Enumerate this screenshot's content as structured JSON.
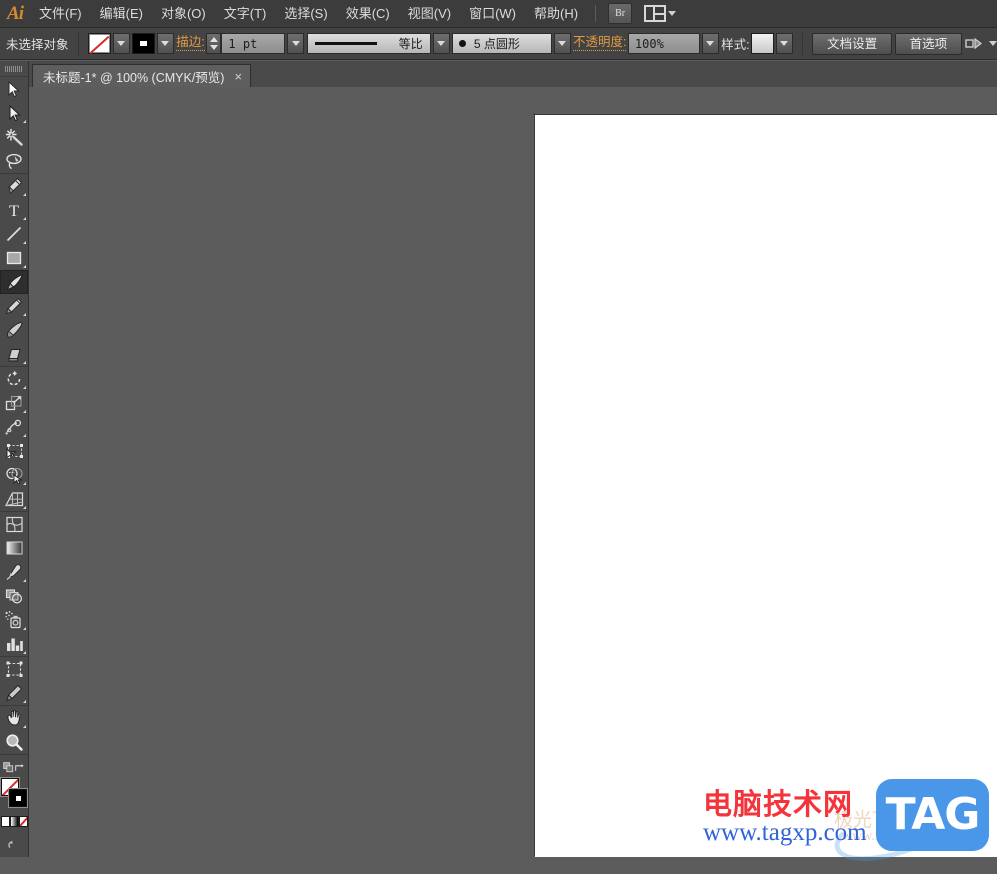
{
  "app": {
    "name": "Adobe Illustrator",
    "logo_text": "Ai",
    "bridge_button": "Br"
  },
  "menubar": {
    "items": [
      {
        "label": "文件(F)",
        "name": "menu-file"
      },
      {
        "label": "编辑(E)",
        "name": "menu-edit"
      },
      {
        "label": "对象(O)",
        "name": "menu-object"
      },
      {
        "label": "文字(T)",
        "name": "menu-type"
      },
      {
        "label": "选择(S)",
        "name": "menu-select"
      },
      {
        "label": "效果(C)",
        "name": "menu-effect"
      },
      {
        "label": "视图(V)",
        "name": "menu-view"
      },
      {
        "label": "窗口(W)",
        "name": "menu-window"
      },
      {
        "label": "帮助(H)",
        "name": "menu-help"
      }
    ]
  },
  "controlbar": {
    "selection_status": "未选择对象",
    "fill_swatch_value": "无",
    "stroke_swatch_value": "黑色",
    "stroke_label": "描边:",
    "stroke_weight": "1 pt",
    "stroke_profile": "等比",
    "brush_definition": "5 点圆形",
    "opacity_label": "不透明度:",
    "opacity_value": "100%",
    "style_label": "样式:",
    "document_setup_button": "文档设置",
    "preferences_button": "首选项"
  },
  "tabbar": {
    "document_title": "未标题-1* @ 100% (CMYK/预览)",
    "close_glyph": "×"
  },
  "toolbar": {
    "groups": [
      [
        {
          "name": "selection-tool",
          "label": "选择工具",
          "active": false,
          "corner": false
        },
        {
          "name": "direct-selection-tool",
          "label": "直接选择工具",
          "active": false,
          "corner": true
        },
        {
          "name": "magic-wand-tool",
          "label": "魔棒工具",
          "active": false,
          "corner": false
        },
        {
          "name": "lasso-tool",
          "label": "套索工具",
          "active": false,
          "corner": false
        }
      ],
      [
        {
          "name": "pen-tool",
          "label": "钢笔工具",
          "active": false,
          "corner": true
        },
        {
          "name": "type-tool",
          "label": "文字工具",
          "active": false,
          "corner": true
        },
        {
          "name": "line-segment-tool",
          "label": "直线段工具",
          "active": false,
          "corner": true
        },
        {
          "name": "rectangle-tool",
          "label": "矩形工具",
          "active": false,
          "corner": true
        },
        {
          "name": "paintbrush-tool",
          "label": "画笔工具",
          "active": true,
          "corner": false
        },
        {
          "name": "pencil-tool",
          "label": "铅笔工具",
          "active": false,
          "corner": true
        },
        {
          "name": "blob-brush-tool",
          "label": "斑点画笔工具",
          "active": false,
          "corner": false
        },
        {
          "name": "eraser-tool",
          "label": "橡皮擦工具",
          "active": false,
          "corner": true
        }
      ],
      [
        {
          "name": "rotate-tool",
          "label": "旋转工具",
          "active": false,
          "corner": true
        },
        {
          "name": "scale-tool",
          "label": "比例缩放工具",
          "active": false,
          "corner": true
        },
        {
          "name": "width-tool",
          "label": "宽度工具",
          "active": false,
          "corner": true
        },
        {
          "name": "free-transform-tool",
          "label": "自由变换工具",
          "active": false,
          "corner": false
        },
        {
          "name": "shape-builder-tool",
          "label": "形状生成器工具",
          "active": false,
          "corner": true
        },
        {
          "name": "perspective-grid-tool",
          "label": "透视网格工具",
          "active": false,
          "corner": true
        }
      ],
      [
        {
          "name": "mesh-tool",
          "label": "网格工具",
          "active": false,
          "corner": false
        },
        {
          "name": "gradient-tool",
          "label": "渐变工具",
          "active": false,
          "corner": false
        },
        {
          "name": "eyedropper-tool",
          "label": "吸管工具",
          "active": false,
          "corner": true
        },
        {
          "name": "blend-tool",
          "label": "混合工具",
          "active": false,
          "corner": false
        },
        {
          "name": "symbol-sprayer-tool",
          "label": "符号喷枪工具",
          "active": false,
          "corner": true
        },
        {
          "name": "column-graph-tool",
          "label": "柱形图工具",
          "active": false,
          "corner": true
        }
      ],
      [
        {
          "name": "artboard-tool",
          "label": "画板工具",
          "active": false,
          "corner": false
        },
        {
          "name": "slice-tool",
          "label": "切片工具",
          "active": false,
          "corner": true
        }
      ],
      [
        {
          "name": "hand-tool",
          "label": "抓手工具",
          "active": false,
          "corner": true
        },
        {
          "name": "zoom-tool",
          "label": "缩放工具",
          "active": false,
          "corner": false
        }
      ]
    ],
    "fill_value": "无",
    "stroke_value": "黑色",
    "color_modes": [
      "颜色",
      "渐变",
      "无"
    ]
  },
  "watermark": {
    "site_name_cn": "电脑技术网",
    "site_url": "www.tagxp.com",
    "logo_text": "TAG",
    "ghost_text": "极光下载站",
    "ghost_url": "www.xz7.com"
  },
  "colors": {
    "chrome_dark": "#3c3c3c",
    "chrome_mid": "#4a4a4a",
    "canvas_gray": "#5c5c5c",
    "artboard_white": "#ffffff",
    "accent_orange": "#e09a42",
    "logo_orange": "#d6892f",
    "watermark_red": "#f5333a",
    "watermark_blue": "#2f63d8",
    "tag_blue": "#4a97ea"
  }
}
